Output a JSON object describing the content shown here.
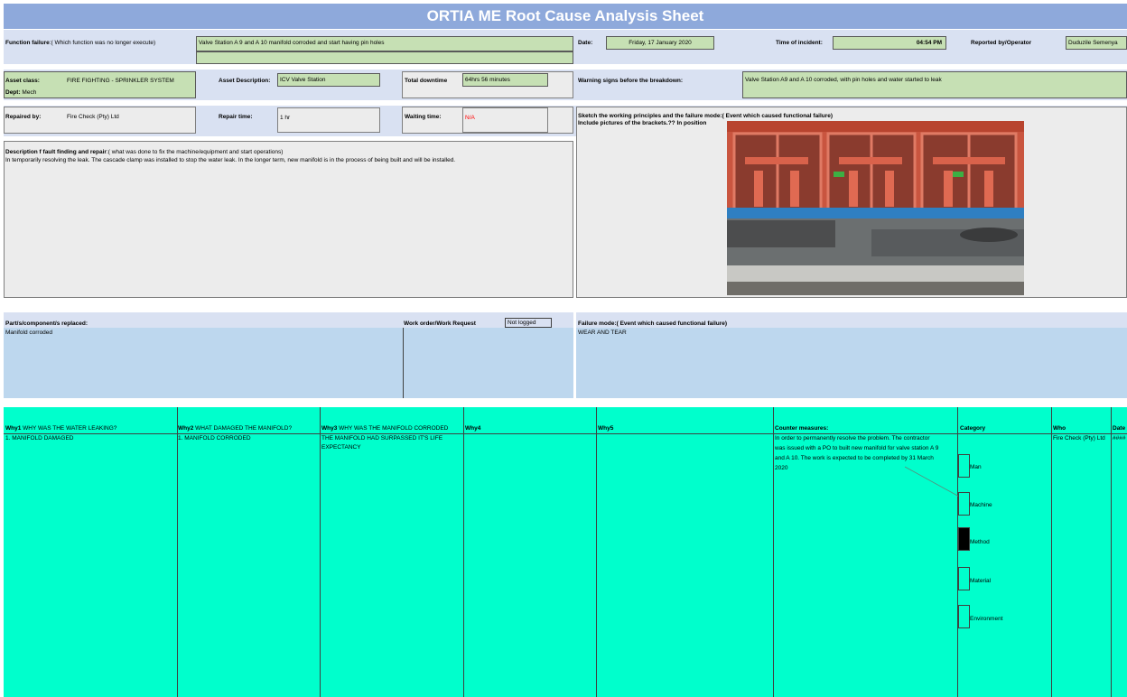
{
  "title": "ORTIA ME Root Cause Analysis Sheet",
  "row1": {
    "function_failure_label": "Function failure",
    "function_failure_hint": ":( Which function was no longer execute)",
    "function_failure_value": "Valve Station A 9 and A 10 manifold corroded and start having pin holes",
    "date_label": "Date:",
    "date_value": "Friday, 17 January 2020",
    "time_label": "Time of incident:",
    "time_value": "04:54 PM",
    "reported_label": "Reported by/Operator",
    "reported_value": "Duduzile Semenya"
  },
  "row2": {
    "asset_class_label": "Asset class:",
    "asset_class_value": "FIRE FIGHTING - SPRINKLER SYSTEM",
    "dept_label": "Dept:",
    "dept_value": "Mech",
    "asset_desc_label": "Asset Description:",
    "asset_desc_value": "ICV Valve Station",
    "downtime_label": "Total downtime",
    "downtime_value": "64hrs 56 minutes",
    "warning_label": "Warning signs before the breakdown:",
    "warning_value": "Valve Station A9 and A 10 corroded, with pin holes and water started to leak"
  },
  "row3": {
    "repaired_label": "Repaired by:",
    "repaired_value": "Fire Check (Pty) Ltd",
    "repair_time_label": "Repair time:",
    "repair_time_value": "1 hr",
    "waiting_label": "Waiting time:",
    "waiting_value": "N/A",
    "sketch_label": "Sketch the working principles and the failure mode:( Event which caused functional failure)",
    "sketch_sub": "Include pictures of the brackets.?? In position"
  },
  "description": {
    "label": "Description f fault finding and repair",
    "hint": ":( what was done to fix the machine/equipment and start operations)",
    "text": "In temporarily resolving the leak. The cascade clamp was installed to stop the water leak. In the longer term, new manifold is in the process of being built and will be installed."
  },
  "parts": {
    "label": "Part/s/component/s  replaced:",
    "value": "Manifold corroded",
    "wo_label": "Work order/Work Request",
    "wo_value": "Not logged",
    "failure_mode_label": "Failure mode:( Event which caused functional failure)",
    "failure_mode_value": "WEAR AND TEAR"
  },
  "whys": {
    "why1_label": "Why1",
    "why1_q": "WHY WAS THE WATER LEAKING?",
    "why1_a": "1. MANIFOLD DAMAGED",
    "why2_label": "Why2",
    "why2_q": "WHAT DAMAGED THE MANIFOLD?",
    "why2_a": "1. MANIFOLD CORRODED",
    "why3_label": "Why3",
    "why3_q": "WHY WAS THE MANIFOLD CORRODED",
    "why3_a1": "THE MANIFOLD HAD SURPASSED IT'S LIFE",
    "why3_a2": "EXPECTANCY",
    "why4_label": "Why4",
    "why5_label": "Why5",
    "counter_label": "Counter measures:",
    "counter_lines": [
      "In order to permanently resolve the problem. The contractor",
      "was issued with a PO to built new manifold for valve station A 9",
      "and A 10. The work is expected to be completed by 31 March",
      "2020"
    ],
    "category_label": "Category",
    "categories": [
      "Man",
      "Machine",
      "Method",
      "Material",
      "Environment"
    ],
    "who_label": "Who",
    "who_value": "Fire Check (Pty) Ltd",
    "date_label": "Date",
    "date_value": "####"
  },
  "colors": {
    "title_bg": "#8ea9db",
    "field_green": "#c6e0b4",
    "panel_blue": "#bdd7ee",
    "whys_aqua": "#00ffcc",
    "red_text": "#ff0000"
  }
}
